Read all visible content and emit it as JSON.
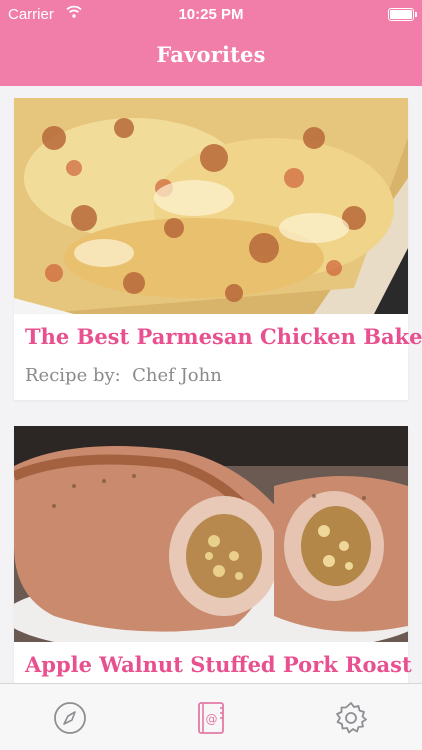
{
  "status_bar": {
    "carrier": "Carrier",
    "time": "10:25 PM"
  },
  "nav": {
    "title": "Favorites"
  },
  "recipes": [
    {
      "title": "The Best Parmesan Chicken Bake",
      "byline_prefix": "Recipe by:",
      "author": "Chef John",
      "image": "parmesan-chicken-bake-photo"
    },
    {
      "title": "Apple Walnut Stuffed Pork Roast",
      "image": "stuffed-pork-roast-photo"
    }
  ],
  "tabs": [
    {
      "icon": "compass-icon"
    },
    {
      "icon": "recipe-book-icon"
    },
    {
      "icon": "gear-icon"
    }
  ],
  "colors": {
    "accent": "#f17ea8",
    "title_pink": "#e8508f",
    "tab_active": "#e37aa6"
  }
}
